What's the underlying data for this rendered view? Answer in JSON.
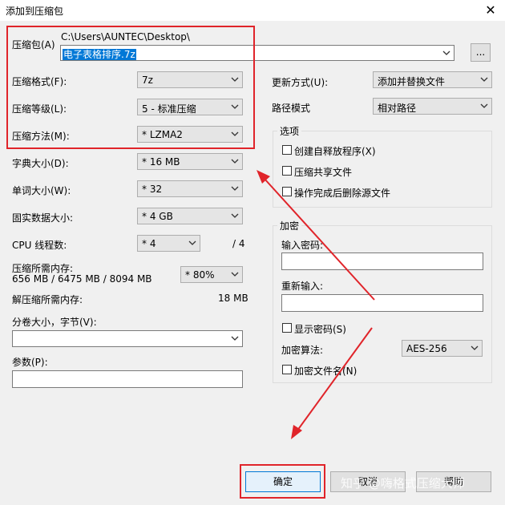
{
  "window": {
    "title": "添加到压缩包",
    "close_glyph": "✕"
  },
  "archive": {
    "label": "压缩包(A)",
    "path": "C:\\Users\\AUNTEC\\Desktop\\",
    "filename": "电子表格排序.7z",
    "browse_label": "..."
  },
  "left_settings": [
    {
      "label": "压缩格式(F):",
      "value": "7z"
    },
    {
      "label": "压缩等级(L):",
      "value": "5 - 标准压缩"
    },
    {
      "label": "压缩方法(M):",
      "value": "* LZMA2"
    },
    {
      "label": "字典大小(D):",
      "value": "* 16 MB"
    },
    {
      "label": "单词大小(W):",
      "value": "* 32"
    },
    {
      "label": "固实数据大小:",
      "value": "* 4 GB"
    }
  ],
  "cpu": {
    "label": "CPU 线程数:",
    "value": "* 4",
    "max": "/ 4"
  },
  "memory": {
    "compress_label": "压缩所需内存:",
    "compress_detail": "656 MB / 6475 MB / 8094 MB",
    "compress_percent": "* 80%",
    "decompress_label": "解压缩所需内存:",
    "decompress_value": "18 MB"
  },
  "volume": {
    "label": "分卷大小，字节(V):",
    "value": ""
  },
  "params": {
    "label": "参数(P):",
    "value": ""
  },
  "update": {
    "label": "更新方式(U):",
    "value": "添加并替换文件"
  },
  "pathmode": {
    "label": "路径模式",
    "value": "相对路径"
  },
  "options": {
    "title": "选项",
    "items": [
      "创建自释放程序(X)",
      "压缩共享文件",
      "操作完成后删除源文件"
    ]
  },
  "encryption": {
    "title": "加密",
    "password_label": "输入密码:",
    "reenter_label": "重新输入:",
    "show_password": "显示密码(S)",
    "method_label": "加密算法:",
    "method_value": "AES-256",
    "encrypt_names": "加密文件名(N)"
  },
  "buttons": {
    "ok": "确定",
    "cancel": "取消",
    "help": "帮助"
  },
  "watermark": "知乎 @嗨格式压缩大师",
  "annotation_color": "#e0242a"
}
